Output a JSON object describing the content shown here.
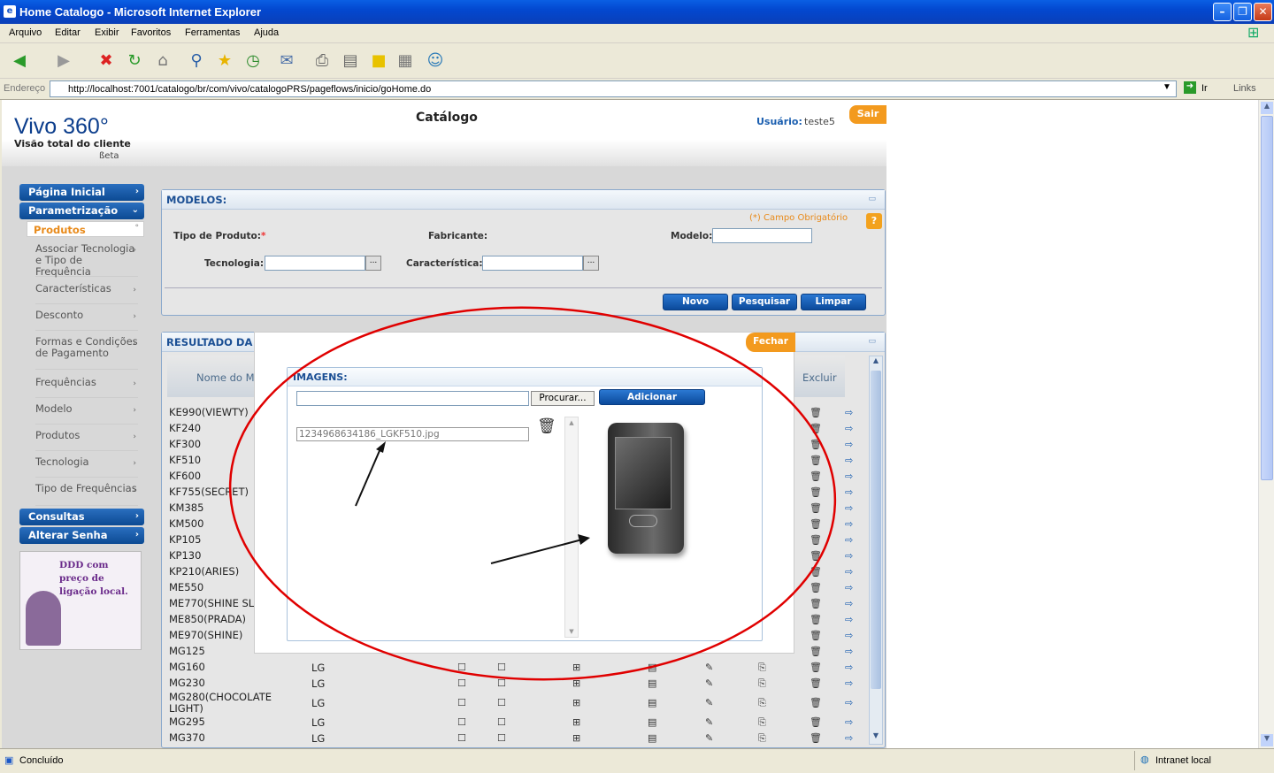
{
  "window": {
    "title": "Home Catalogo - Microsoft Internet Explorer",
    "menu": [
      "Arquivo",
      "Editar",
      "Exibir",
      "Favoritos",
      "Ferramentas",
      "Ajuda"
    ]
  },
  "address": {
    "label": "Endereço",
    "url": "http://localhost:7001/catalogo/br/com/vivo/catalogoPRS/pageflows/inicio/goHome.do",
    "go": "Ir",
    "links": "Links"
  },
  "header": {
    "brand": "Vivo 360°",
    "tagline": "Visão total do cliente",
    "beta": "ßeta",
    "page_title": "Catálogo",
    "user_label": "Usuário:",
    "user_name": "teste5",
    "logout": "Sair"
  },
  "sidebar": {
    "main": [
      {
        "label": "Página Inicial"
      },
      {
        "label": "Parametrização"
      }
    ],
    "active": "Produtos",
    "items": [
      "Associar Tecnologia e Tipo de Frequência",
      "Características",
      "Desconto",
      "Formas e Condições de Pagamento",
      "Frequências",
      "Modelo",
      "Produtos",
      "Tecnologia",
      "Tipo de Frequências"
    ],
    "bottom": [
      "Consultas",
      "Alterar Senha"
    ],
    "ad": "DDD com preço de ligação local."
  },
  "models_panel": {
    "title": "MODELOS:",
    "required": "(*) Campo Obrigatório",
    "tipo": "Tipo de Produto:",
    "tipo_req": "*",
    "fabricante": "Fabricante:",
    "modelo": "Modelo:",
    "tecnologia": "Tecnologia:",
    "caracteristica": "Característica:",
    "ellipsis": "...",
    "buttons": {
      "novo": "Novo",
      "pesquisar": "Pesquisar",
      "limpar": "Limpar"
    }
  },
  "results_panel": {
    "title": "RESULTADO DA",
    "col_name": "Nome do M",
    "col_excluir": "Excluir",
    "rows": [
      "KE990(VIEWTY)",
      "KF240",
      "KF300",
      "KF510",
      "KF600",
      "KF755(SECRET)",
      "KM385",
      "KM500",
      "KP105",
      "KP130",
      "KP210(ARIES)",
      "ME550",
      "ME770(SHINE SL",
      "ME850(PRADA)",
      "ME970(SHINE)",
      "MG125",
      "MG160",
      "MG230",
      "MG280(CHOCOLATE LIGHT)",
      "MG295",
      "MG370"
    ],
    "manufacturer": "LG"
  },
  "modal": {
    "close": "Fechar",
    "title": "IMAGENS:",
    "browse": "Procurar...",
    "add": "Adicionar",
    "file": "1234968634186_LGKF510.jpg"
  },
  "status": {
    "text": "Concluído",
    "zone": "Intranet local"
  },
  "colors": {
    "accent": "#0b4a9b",
    "orange": "#f39a1e",
    "annotation": "#e00000"
  }
}
